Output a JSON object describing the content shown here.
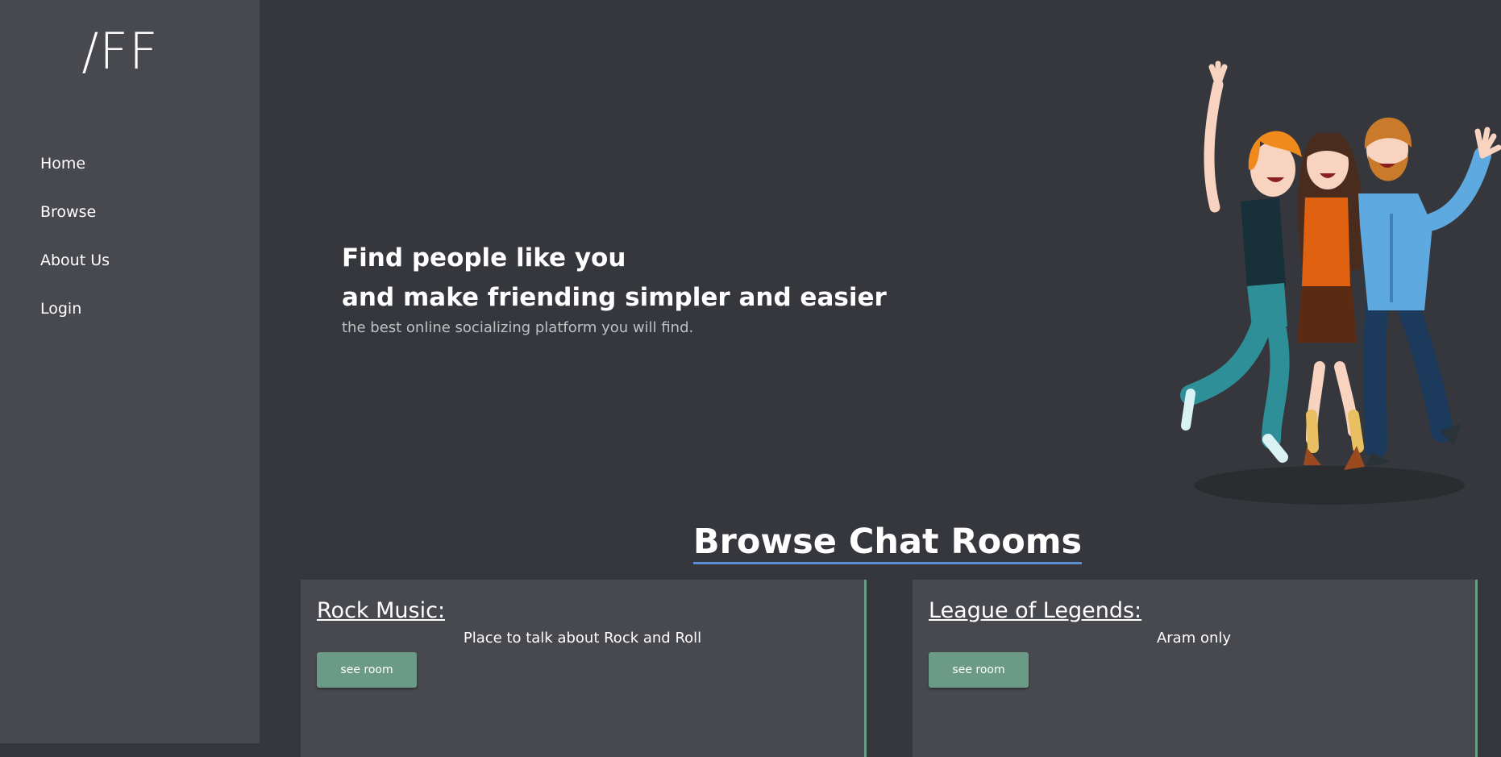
{
  "sidebar": {
    "logo": "/FF",
    "nav": [
      "Home",
      "Browse",
      "About Us",
      "Login"
    ]
  },
  "hero": {
    "line1": "Find people like you",
    "line2": "and make friending simpler and easier",
    "subtitle": "the best online socializing platform you will find."
  },
  "browse": {
    "title": "Browse Chat Rooms",
    "rooms": [
      {
        "name": "Rock Music:",
        "description": "Place to talk about Rock and Roll",
        "button": "see room"
      },
      {
        "name": "League of Legends:",
        "description": "Aram only",
        "button": "see room"
      }
    ]
  },
  "colors": {
    "background": "#36373c",
    "sidebar": "#48494e",
    "card": "#48494e",
    "accent_green": "#6b9b86",
    "underline_blue": "#5a8fd6"
  },
  "icons": {
    "hero_illustration": "three-friends-celebrating-illustration"
  }
}
